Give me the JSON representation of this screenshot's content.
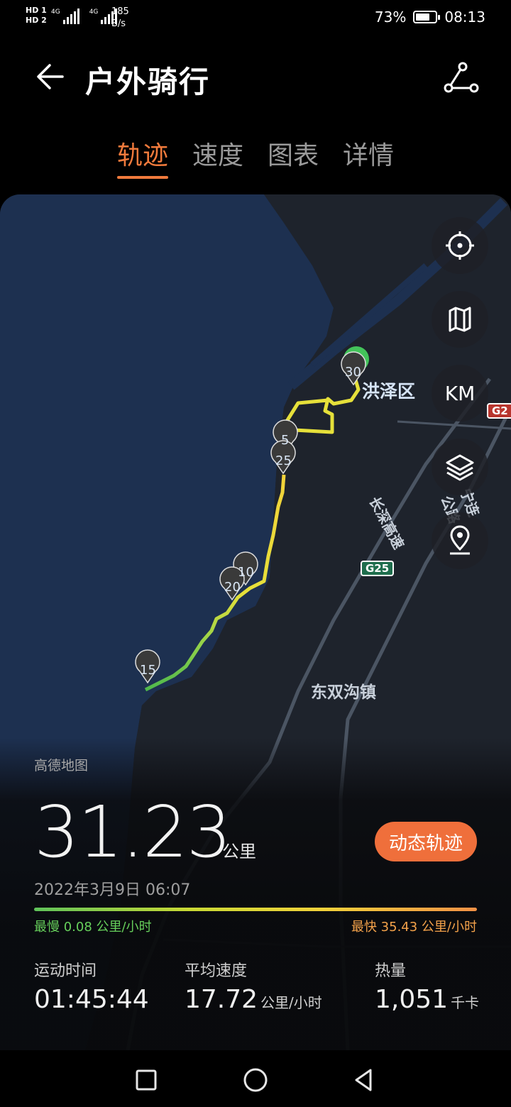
{
  "status": {
    "left_labels": [
      "HD 1",
      "HD 2"
    ],
    "network": [
      "4G",
      "4G"
    ],
    "speed_value": "185",
    "speed_unit": "B/s",
    "battery": "73%",
    "battery_level": 0.73,
    "time": "08:13"
  },
  "header": {
    "title": "户外骑行",
    "back_icon": "arrow-left-icon",
    "route_icon": "route-share-icon"
  },
  "tabs": [
    {
      "label": "轨迹",
      "active": true
    },
    {
      "label": "速度",
      "active": false
    },
    {
      "label": "图表",
      "active": false
    },
    {
      "label": "详情",
      "active": false
    }
  ],
  "map": {
    "labels": {
      "district": "洪泽区",
      "town": "东双沟镇",
      "road_a": "长深高速",
      "road_b": "宁连公路",
      "shield_g25": "G25",
      "shield_g2": "G2"
    },
    "markers": [
      "5",
      "10",
      "15",
      "20",
      "25",
      "30"
    ],
    "buttons": [
      {
        "name": "locate-button",
        "icon": "crosshair-icon"
      },
      {
        "name": "map-type-button",
        "icon": "map-icon"
      },
      {
        "name": "km-button",
        "label": "KM"
      },
      {
        "name": "layers-button",
        "icon": "layers-icon"
      },
      {
        "name": "location-pin-button",
        "icon": "location-pin-icon"
      }
    ],
    "provider": "高德地图"
  },
  "summary": {
    "distance": "31.23",
    "distance_unit": "公里",
    "dynamic_track_button": "动态轨迹",
    "datetime": "2022年3月9日 06:07",
    "slowest": "最慢 0.08 公里/小时",
    "fastest": "最快 35.43 公里/小时",
    "colors": {
      "slow": "#66cf5b",
      "fast": "#f4a24a",
      "accent": "#ef6f3b"
    }
  },
  "stats": [
    {
      "label": "运动时间",
      "value": "01:45:44",
      "unit": ""
    },
    {
      "label": "平均速度",
      "value": "17.72",
      "unit": "公里/小时"
    },
    {
      "label": "热量",
      "value": "1,051",
      "unit": "千卡"
    }
  ],
  "navbar": {
    "icons": [
      "square-icon",
      "circle-icon",
      "triangle-back-icon"
    ]
  }
}
